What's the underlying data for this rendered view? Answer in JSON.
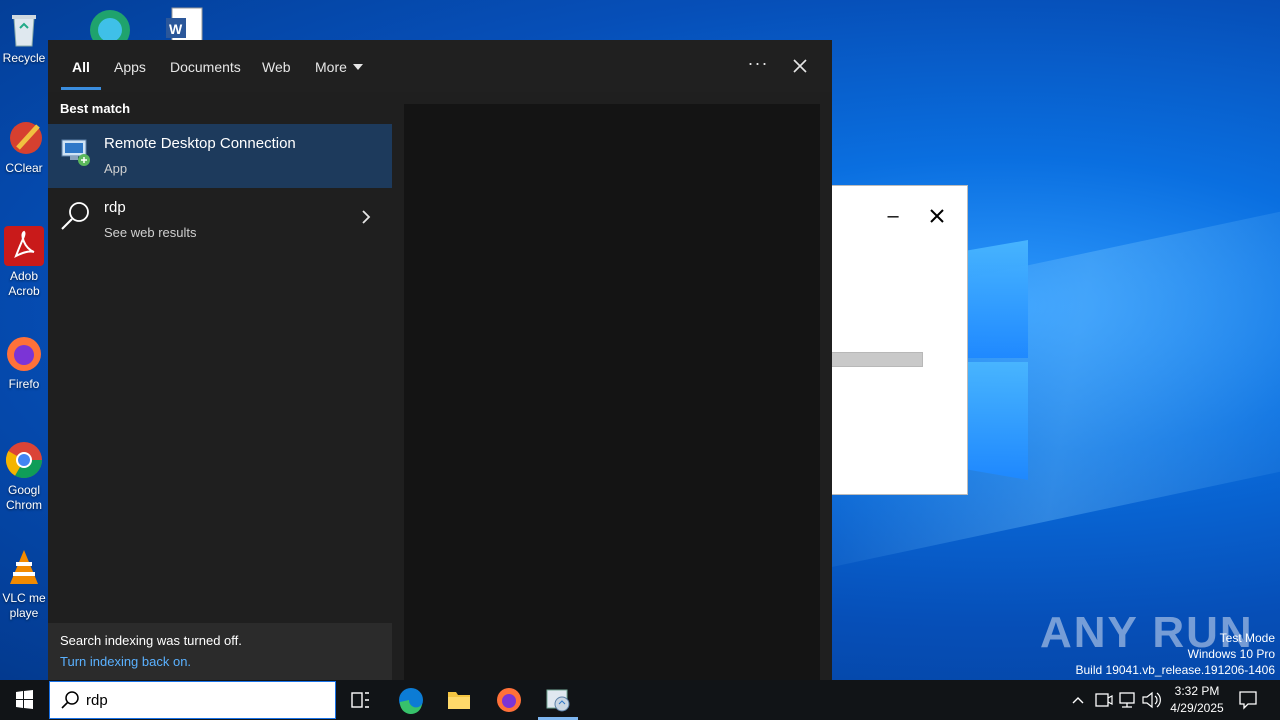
{
  "desktop": {
    "icons": [
      {
        "label": "Recycle",
        "top": 0
      },
      {
        "label": "CClear",
        "top": 0
      },
      {
        "label": "Adob Acrob",
        "top": 0
      },
      {
        "label": "Firefo",
        "top": 0
      },
      {
        "label": "Googl Chrom",
        "top": 0
      },
      {
        "label": "VLC me playe",
        "top": 0
      }
    ]
  },
  "search_panel": {
    "tabs": [
      {
        "label": "All"
      },
      {
        "label": "Apps"
      },
      {
        "label": "Documents"
      },
      {
        "label": "Web"
      },
      {
        "label": "More"
      }
    ],
    "ellipsis": "···",
    "best_match_label": "Best match",
    "results": [
      {
        "title": "Remote Desktop Connection",
        "subtitle": "App",
        "icon": "remote-desktop-icon"
      },
      {
        "title": "rdp",
        "subtitle": "See web results",
        "icon": "search-icon"
      }
    ],
    "notice": {
      "text": "Search indexing was turned off.",
      "link": "Turn indexing back on."
    }
  },
  "taskbar": {
    "search_value": "rdp",
    "clock_time": "3:32 PM",
    "clock_date": "4/29/2025",
    "pinned": [
      "task-view-icon",
      "edge-icon",
      "file-explorer-icon",
      "firefox-icon",
      "rdp-app-icon"
    ]
  },
  "watermark": {
    "brand": "ANY RUN",
    "test_mode": "Test Mode",
    "edition": "Windows 10 Pro",
    "build": "Build 19041.vb_release.191206-1406"
  },
  "colors": {
    "selection": "#1d3a5c",
    "link": "#5ab1ff",
    "accent": "#3a8dde",
    "panel_bg": "#1f1f1f"
  }
}
